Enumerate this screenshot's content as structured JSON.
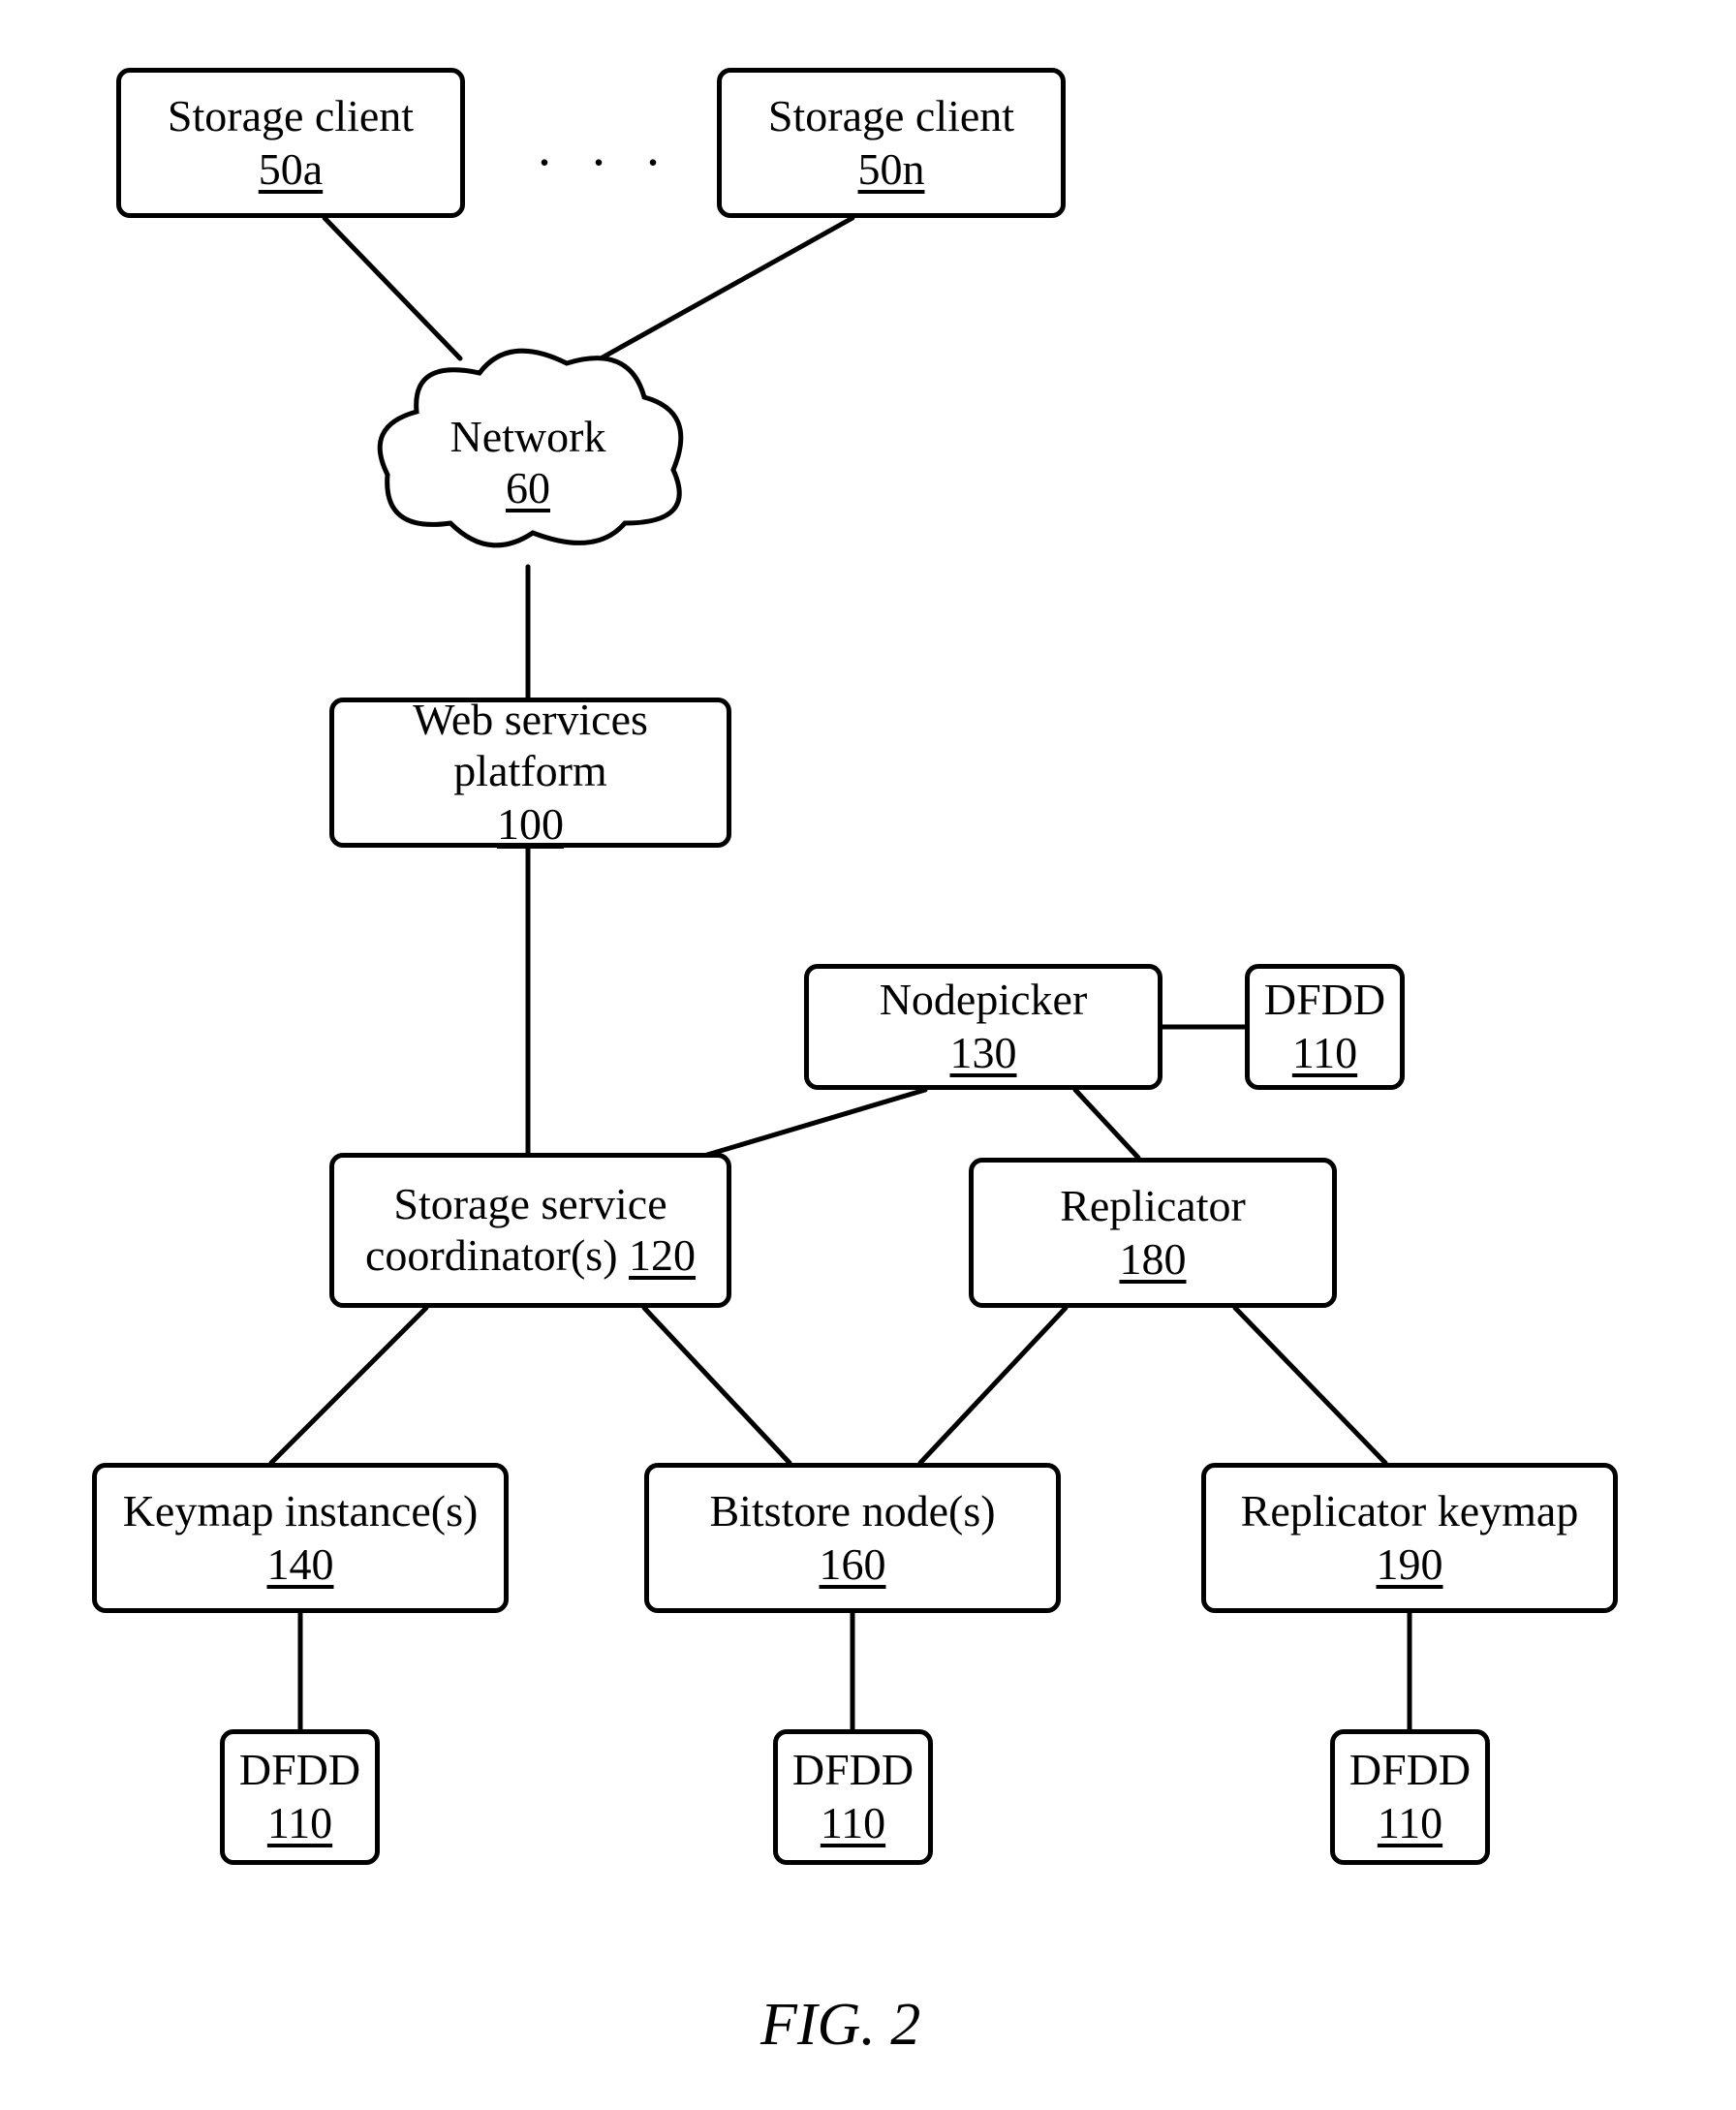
{
  "figure_caption": "FIG. 2",
  "ellipsis": ". . .",
  "cloud": {
    "label": "Network",
    "ref": "60"
  },
  "boxes": {
    "client_a": {
      "label": "Storage client",
      "ref": "50a"
    },
    "client_n": {
      "label": "Storage client",
      "ref": "50n"
    },
    "wsp": {
      "label": "Web services platform",
      "ref": "100"
    },
    "nodepicker": {
      "label": "Nodepicker",
      "ref": "130"
    },
    "dfdd_np": {
      "label": "DFDD",
      "ref": "110"
    },
    "ssc": {
      "line1": "Storage service",
      "line2_pre": "coordinator(s) ",
      "ref": "120"
    },
    "replicator": {
      "label": "Replicator",
      "ref": "180"
    },
    "keymap": {
      "label": "Keymap instance(s)",
      "ref": "140"
    },
    "bitstore": {
      "label": "Bitstore node(s)",
      "ref": "160"
    },
    "repkeymap": {
      "label": "Replicator keymap",
      "ref": "190"
    },
    "dfdd_km": {
      "label": "DFDD",
      "ref": "110"
    },
    "dfdd_bs": {
      "label": "DFDD",
      "ref": "110"
    },
    "dfdd_rk": {
      "label": "DFDD",
      "ref": "110"
    }
  }
}
